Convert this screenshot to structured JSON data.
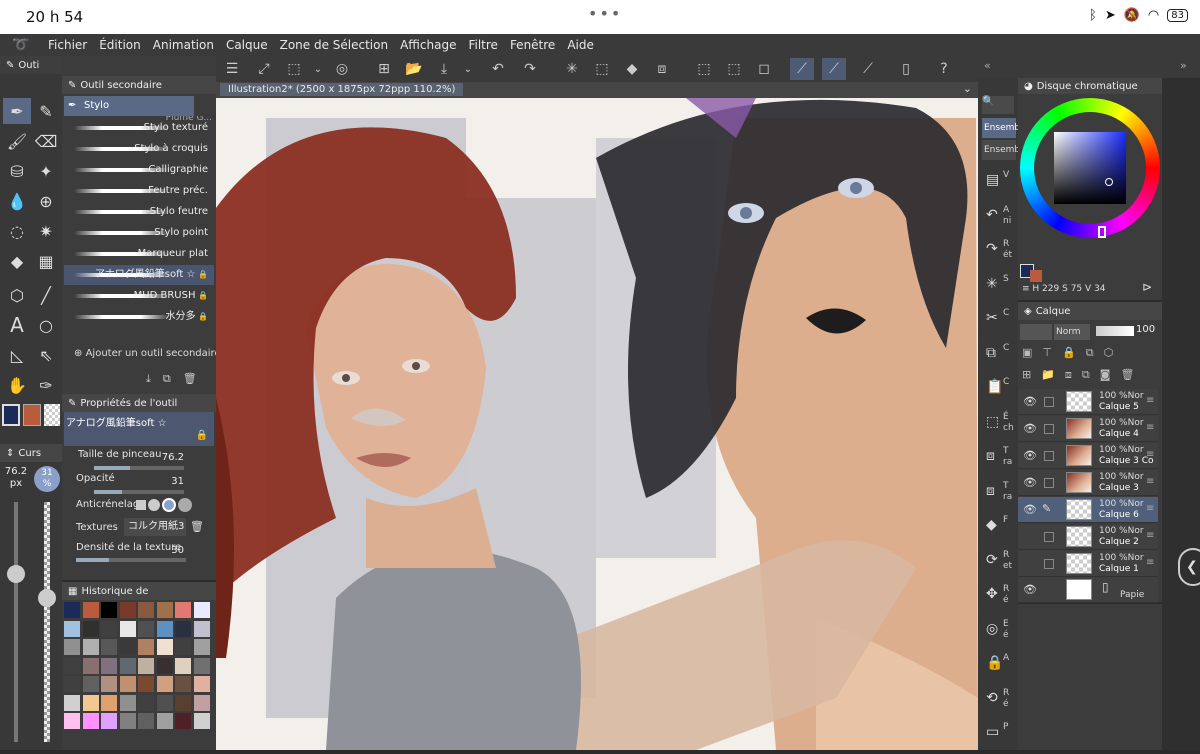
{
  "status": {
    "time": "20 h 54",
    "dots": "•••",
    "battery": "83"
  },
  "menu": [
    "Fichier",
    "Édition",
    "Animation",
    "Calque",
    "Zone de Sélection",
    "Affichage",
    "Filtre",
    "Fenêtre",
    "Aide"
  ],
  "left_panel": {
    "tool_tab": "Outi",
    "subtool_tab": "Outil secondaire",
    "subtool_group": "Stylo",
    "cut_label": "Plume G...",
    "brushes": [
      {
        "name": "Stylo texturé",
        "locked": false
      },
      {
        "name": "Stylo à croquis",
        "locked": false
      },
      {
        "name": "Calligraphie",
        "locked": false
      },
      {
        "name": "Feutre préc.",
        "locked": false
      },
      {
        "name": "Stylo feutre",
        "locked": false
      },
      {
        "name": "Stylo point",
        "locked": false
      },
      {
        "name": "Marqueur plat",
        "locked": false
      },
      {
        "name": "アナログ風鉛筆soft ☆",
        "locked": true
      },
      {
        "name": "MUD BRUSH",
        "locked": true
      },
      {
        "name": "水分多",
        "locked": true
      }
    ],
    "add_subtool": "Ajouter un outil secondaire",
    "properties_title": "Propriétés de l'outil",
    "current_brush": "アナログ風鉛筆soft ☆",
    "brush_size_label": "Taille de pinceau",
    "brush_size_value": "76.2",
    "opacity_label": "Opacité",
    "opacity_value": "31",
    "antialias_label": "Anticrénelage",
    "textures_label": "Textures",
    "texture_value": "コルク用紙3",
    "texture_density_label": "Densité de la texture",
    "texture_density_value": "30",
    "cursor_tab": "Curs",
    "size_readout": "76.2",
    "size_unit": "px",
    "opacity_readout": "31",
    "opacity_unit": "%",
    "size_slider_level": 0.3,
    "opacity_slider_level": 0.4,
    "history_title": "Historique de",
    "palette": [
      "#1c2a5a",
      "#b85c3c",
      "#000000",
      "#7a3a2a",
      "#8a5a40",
      "#a0704a",
      "#e07a70",
      "#e8e8ff",
      "#a0c0e0",
      "#303030",
      "#404040",
      "#e8e8e8",
      "#505050",
      "#6090c0",
      "#2a3040",
      "#c0c0d0",
      "#909090",
      "#b0b0b0",
      "#585858",
      "#3a3a3a",
      "#b08060",
      "#f0e0d0",
      "#404040",
      "#a0a0a0",
      "#404040",
      "#887070",
      "#807080",
      "#606870",
      "#c0b0a0",
      "#383030",
      "#e0d0c0",
      "#707070",
      "#404040",
      "#606060",
      "#b09080",
      "#c09070",
      "#7a4a30",
      "#d0a080",
      "#6a5040",
      "#e0b0a0",
      "#d0d0d0",
      "#f0c890",
      "#e0a070",
      "#909090",
      "#404040",
      "#505050",
      "#584030",
      "#c0a0a0",
      "#ffc0f0",
      "#ff90ff",
      "#e0a0ff",
      "#808080",
      "#606060",
      "#a0a0a0",
      "#502028",
      "#d0d0d0"
    ],
    "main_color": "#1c2a5a",
    "sub_color": "#b85c3c"
  },
  "document": {
    "tab_title": "Illustration2* (2500 x 1875px 72ppp 110.2%)"
  },
  "right_panel": {
    "side_tabs": [
      "Ensemb",
      "Ensemb"
    ],
    "color_title": "Disque chromatique",
    "hsv": {
      "h": "229",
      "s": "75",
      "v": "34"
    },
    "layer_title": "Calque",
    "blend": "Norm",
    "opacity": "100",
    "layers": [
      {
        "opacity": "100 %Nor",
        "name": "Calque 5",
        "visible": true,
        "selected": false,
        "thumb": "checker"
      },
      {
        "opacity": "100 %Nor",
        "name": "Calque 4",
        "visible": true,
        "selected": false,
        "thumb": "art"
      },
      {
        "opacity": "100 %Nor",
        "name": "Calque 3 Co",
        "visible": true,
        "selected": false,
        "thumb": "art"
      },
      {
        "opacity": "100 %Nor",
        "name": "Calque 3",
        "visible": true,
        "selected": false,
        "thumb": "art"
      },
      {
        "opacity": "100 %Nor",
        "name": "Calque 6",
        "visible": true,
        "selected": true,
        "thumb": "checker"
      },
      {
        "opacity": "100 %Nor",
        "name": "Calque 2",
        "visible": false,
        "selected": false,
        "thumb": "checker"
      },
      {
        "opacity": "100 %Nor",
        "name": "Calque 1",
        "visible": false,
        "selected": false,
        "thumb": "checker"
      }
    ],
    "paper_label": "Papie",
    "commands": [
      {
        "icon": "new-icon",
        "label": "V"
      },
      {
        "icon": "undo-icon",
        "label": "A ni"
      },
      {
        "icon": "redo-icon",
        "label": "R ét"
      },
      {
        "icon": "spinner-icon",
        "label": "S"
      },
      {
        "icon": "cut-icon",
        "label": "C"
      },
      {
        "icon": "copy-icon",
        "label": "C"
      },
      {
        "icon": "paste-icon",
        "label": "C"
      },
      {
        "icon": "erase-icon",
        "label": "É ch"
      },
      {
        "icon": "transform-icon",
        "label": "T ra"
      },
      {
        "icon": "transform-icon",
        "label": "T ra"
      },
      {
        "icon": "fill-icon",
        "label": "F"
      },
      {
        "icon": "rotate-icon",
        "label": "R et"
      },
      {
        "icon": "move-icon",
        "label": "R é"
      },
      {
        "icon": "select-icon",
        "label": "E é"
      },
      {
        "icon": "lock-icon",
        "label": "A"
      },
      {
        "icon": "reset-icon",
        "label": "R é"
      },
      {
        "icon": "p-icon",
        "label": "P"
      }
    ]
  }
}
